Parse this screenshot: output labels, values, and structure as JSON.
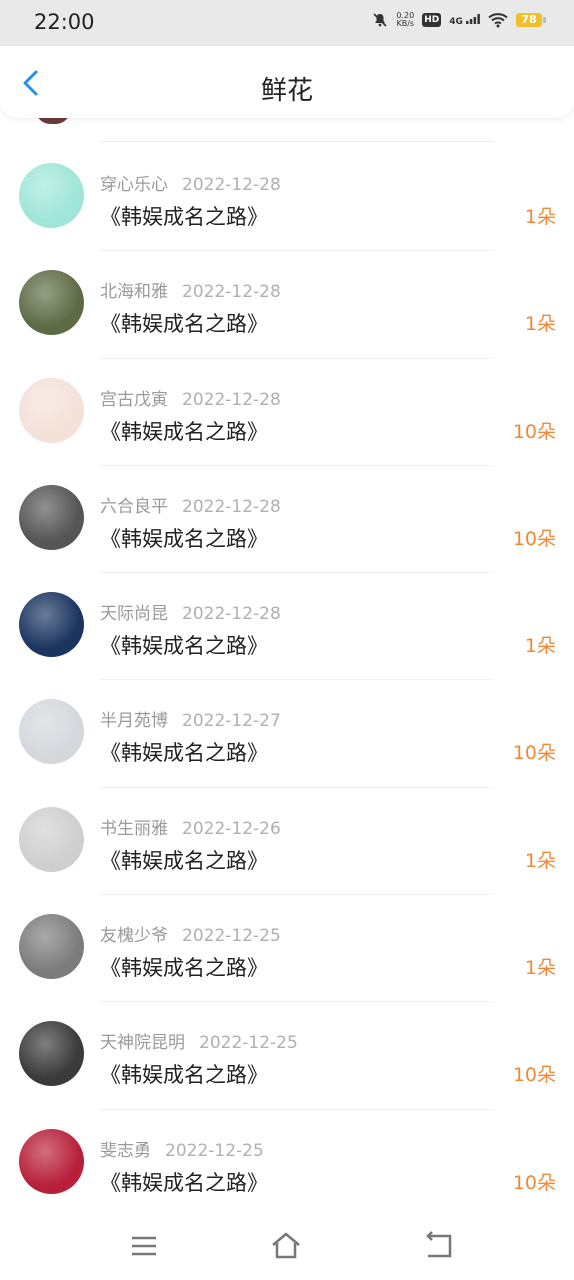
{
  "status": {
    "time": "22:00",
    "speed_value": "0.20",
    "speed_unit": "KB/s",
    "hd": "HD",
    "network": "4G",
    "battery": "78"
  },
  "header": {
    "title": "鲜花"
  },
  "list": [
    {
      "name": "穿心乐心",
      "date": "2022-12-28",
      "book": "《韩娱成名之路》",
      "qty": "1朵",
      "avatar_color": "#9fe6d8",
      "avatar_icon": "cartoon-sprout-avatar"
    },
    {
      "name": "北海和雅",
      "date": "2022-12-28",
      "book": "《韩娱成名之路》",
      "qty": "1朵",
      "avatar_color": "#5d6b45",
      "avatar_icon": "soldiers-avatar"
    },
    {
      "name": "宫古戊寅",
      "date": "2022-12-28",
      "book": "《韩娱成名之路》",
      "qty": "10朵",
      "avatar_color": "#f4e1d9",
      "avatar_icon": "girl-with-bear-avatar"
    },
    {
      "name": "六合良平",
      "date": "2022-12-28",
      "book": "《韩娱成名之路》",
      "qty": "10朵",
      "avatar_color": "#555555",
      "avatar_icon": "street-bw-avatar"
    },
    {
      "name": "天际尚昆",
      "date": "2022-12-28",
      "book": "《韩娱成名之路》",
      "qty": "1朵",
      "avatar_color": "#1b3560",
      "avatar_icon": "zodiac-avatar"
    },
    {
      "name": "半月苑博",
      "date": "2022-12-27",
      "book": "《韩娱成名之路》",
      "qty": "10朵",
      "avatar_color": "#d4d8dc",
      "avatar_icon": "girl-portrait-avatar"
    },
    {
      "name": "书生丽雅",
      "date": "2022-12-26",
      "book": "《韩娱成名之路》",
      "qty": "1朵",
      "avatar_color": "#cfcfcf",
      "avatar_icon": "finger-faces-avatar"
    },
    {
      "name": "友槐少爷",
      "date": "2022-12-25",
      "book": "《韩娱成名之路》",
      "qty": "1朵",
      "avatar_color": "#7c7c7c",
      "avatar_icon": "child-avatar"
    },
    {
      "name": "天神院昆明",
      "date": "2022-12-25",
      "book": "《韩娱成名之路》",
      "qty": "10朵",
      "avatar_color": "#3a3a3a",
      "avatar_icon": "anime-witch-avatar"
    },
    {
      "name": "斐志勇",
      "date": "2022-12-25",
      "book": "《韩娱成名之路》",
      "qty": "10朵",
      "avatar_color": "#b8203a",
      "avatar_icon": "gift-card-avatar"
    }
  ],
  "nav": {
    "items": [
      "menu-icon",
      "home-icon",
      "back-icon"
    ]
  }
}
